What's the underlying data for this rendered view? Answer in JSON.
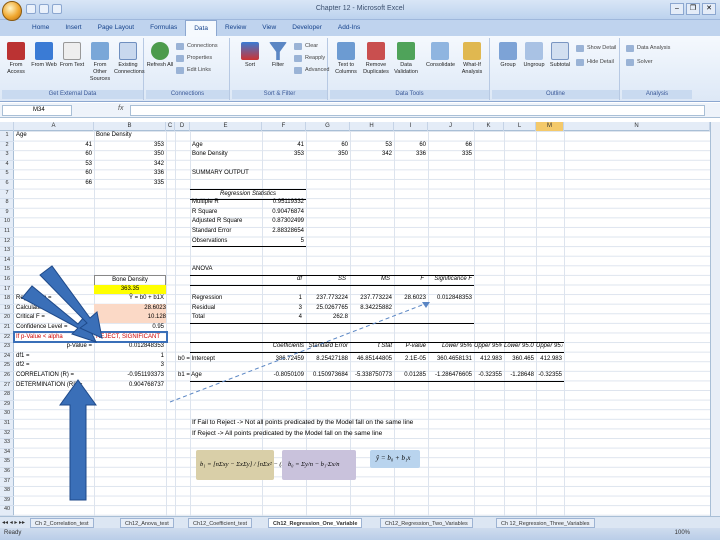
{
  "window": {
    "title": "Chapter 12 - Microsoft Excel",
    "controls": [
      "–",
      "❐",
      "✕"
    ]
  },
  "ribbon_tabs": [
    "Home",
    "Insert",
    "Page Layout",
    "Formulas",
    "Data",
    "Review",
    "View",
    "Developer",
    "Add-Ins"
  ],
  "active_tab": "Data",
  "ribbon": {
    "get_external": {
      "label": "Get External Data",
      "buttons": [
        "From Access",
        "From Web",
        "From Text",
        "From Other Sources",
        "Existing Connections"
      ]
    },
    "connections": {
      "label": "Connections",
      "refresh": "Refresh All",
      "items": [
        "Connections",
        "Properties",
        "Edit Links"
      ]
    },
    "sort_filter": {
      "label": "Sort & Filter",
      "sort": "Sort",
      "filter": "Filter",
      "items": [
        "Clear",
        "Reapply",
        "Advanced"
      ]
    },
    "data_tools": {
      "label": "Data Tools",
      "buttons": [
        "Text to Columns",
        "Remove Duplicates",
        "Data Validation",
        "Consolidate",
        "What-If Analysis"
      ]
    },
    "outline": {
      "label": "Outline",
      "buttons": [
        "Group",
        "Ungroup",
        "Subtotal"
      ],
      "items": [
        "Show Detail",
        "Hide Detail"
      ]
    },
    "analysis": {
      "label": "Analysis",
      "items": [
        "Data Analysis",
        "Solver"
      ]
    }
  },
  "formula_bar": {
    "name_box": "M34",
    "fx": "fx"
  },
  "columns": [
    "A",
    "B",
    "C",
    "D",
    "E",
    "F",
    "G",
    "H",
    "I",
    "J",
    "K",
    "L",
    "M",
    "N"
  ],
  "rows": [
    "1",
    "2",
    "3",
    "4",
    "5",
    "6",
    "7",
    "8",
    "9",
    "10",
    "11",
    "12",
    "13",
    "14",
    "15",
    "16",
    "17",
    "18",
    "19",
    "20",
    "21",
    "22",
    "23",
    "24",
    "25",
    "26",
    "27",
    "28",
    "29",
    "30",
    "31",
    "32",
    "33",
    "34",
    "35",
    "36",
    "37",
    "38",
    "39",
    "40"
  ],
  "cells": {
    "a1": "Age",
    "b1": "Bone Density",
    "data": [
      [
        "41",
        "353"
      ],
      [
        "60",
        "350"
      ],
      [
        "53",
        "342"
      ],
      [
        "60",
        "336"
      ],
      [
        "66",
        "335"
      ]
    ],
    "b16": "Bone Density",
    "b17": "363.35",
    "a18": "Regression =",
    "b18": "Ŷ = b0 + b1X",
    "a19": "Calculated F =",
    "b19": "28.6023",
    "a20": "Critical F =",
    "b20": "10.128",
    "a21": "Confidence Level =",
    "b21": "0.95",
    "a22": "If p-Value < alpha",
    "b22": "REJECT, SIGNIFICANT",
    "a23": "p-Value =",
    "b23": "0.012848353",
    "a24": "df1 =",
    "b24": "1",
    "a25": "df2 =",
    "b25": "3",
    "a26": "CORRELATION (R) =",
    "b26": "-0.951193373",
    "a27": "DETERMINATION (R²) =",
    "b27": "0.904768737"
  },
  "transposed": {
    "e1": "Age",
    "e2": "Bone Density",
    "ages": [
      "41",
      "60",
      "53",
      "60",
      "66"
    ],
    "densities": [
      "353",
      "350",
      "342",
      "336",
      "335"
    ]
  },
  "summary": {
    "title": "SUMMARY OUTPUT",
    "reg_stats_title": "Regression Statistics",
    "reg_stats": [
      [
        "Multiple R",
        "0.95119332"
      ],
      [
        "R Square",
        "0.90476874"
      ],
      [
        "Adjusted R Square",
        "0.87302499"
      ],
      [
        "Standard Error",
        "2.88328654"
      ],
      [
        "Observations",
        "5"
      ]
    ],
    "anova_title": "ANOVA",
    "anova_head": [
      "df",
      "SS",
      "MS",
      "F",
      "Significance F"
    ],
    "anova": [
      [
        "Regression",
        "1",
        "237.773224",
        "237.773224",
        "28.6023",
        "0.012848353"
      ],
      [
        "Residual",
        "3",
        "25.0267765",
        "8.34225882",
        "",
        ""
      ],
      [
        "Total",
        "4",
        "262.8",
        "",
        "",
        ""
      ]
    ],
    "coef_head": [
      "Coefficients",
      "Standard Error",
      "t Stat",
      "P-value",
      "Lower 95%",
      "Upper 95%",
      "Lower 95.0%",
      "Upper 95.0%"
    ],
    "coef": [
      [
        "b0 = Intercept",
        "386.72459",
        "8.25427188",
        "46.85144805",
        "2.1E-05",
        "360.4658131",
        "412.983",
        "360.465",
        "412.983"
      ],
      [
        "b1 = Age",
        "-0.8050109",
        "0.150973684",
        "-5.338750773",
        "0.01285",
        "-1.286476605",
        "-0.32355",
        "-1.28648",
        "-0.32355"
      ]
    ]
  },
  "notes": [
    "If Fail to Reject -> Not all points predicated by the Model fall on the same line",
    "If Reject -> All points predicated by the Model fall on the same line"
  ],
  "formulas": {
    "b1": "b₁ = [nΣxy − ΣxΣy] / [nΣx² − (Σx)²]",
    "b0": "b₀ = Σy/n − b₁·Σx/n",
    "yhat": "ŷ = b₀ + b₁x"
  },
  "colors": {
    "yellow": "#ffff00",
    "peach": "#fbd9c6",
    "arrow_blue": "#3a6fb8",
    "b1_box": "#d9cfa8",
    "b0_box": "#c9c2dc",
    "yhat_box": "#b9d4ee"
  },
  "sheet_tabs": [
    "Ch 2_Correlation_test",
    "Ch12_Anova_test",
    "Ch12_Coefficient_test",
    "Ch12_Regression_One_Variable",
    "Ch12_Regression_Two_Variables",
    "Ch 12_Regression_Three_Variables"
  ],
  "active_sheet": "Ch12_Regression_One_Variable",
  "status": {
    "ready": "Ready",
    "zoom": "100%"
  }
}
